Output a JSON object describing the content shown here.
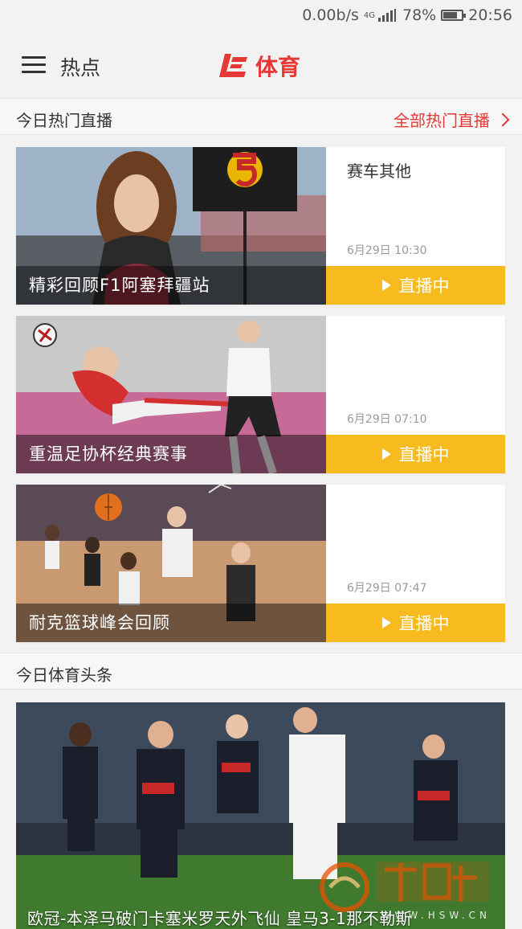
{
  "status_bar": {
    "network_speed": "0.00b/s",
    "network_type": "4G",
    "battery_percent": "78%",
    "battery_level": 0.78,
    "time": "20:56"
  },
  "app_bar": {
    "menu_label": "热点",
    "brand_title": "体育"
  },
  "live_section": {
    "title": "今日热门直播",
    "more_label": "全部热门直播"
  },
  "live_items": [
    {
      "caption": "精彩回顾F1阿塞拜疆站",
      "category": "赛车其他",
      "time": "6月29日 10:30",
      "status": "直播中"
    },
    {
      "caption": "重温足协杯经典赛事",
      "category": "",
      "time": "6月29日 07:10",
      "status": "直播中"
    },
    {
      "caption": "耐克篮球峰会回顾",
      "category": "",
      "time": "6月29日 07:47",
      "status": "直播中"
    }
  ],
  "headlines_section": {
    "title": "今日体育头条"
  },
  "headline": {
    "caption": "欧冠-本泽马破门卡塞米罗天外飞仙 皇马3-1那不勒斯",
    "watermark_text": "WWW.HSW.CN"
  },
  "colors": {
    "brand_red": "#e53935",
    "live_yellow": "#f7bb20"
  }
}
